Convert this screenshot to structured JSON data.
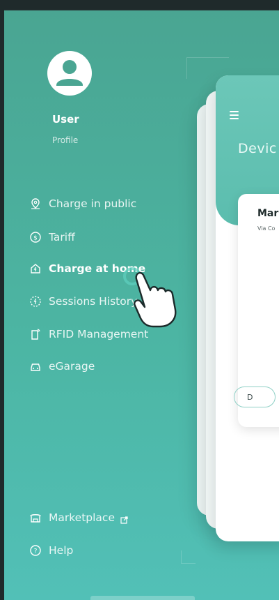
{
  "user": {
    "name": "User",
    "subtitle": "Profile"
  },
  "nav": {
    "items": [
      {
        "label": "Charge in public",
        "icon": "location-pin-icon",
        "active": false
      },
      {
        "label": "Tariff",
        "icon": "dollar-circle-icon",
        "active": false
      },
      {
        "label": "Charge at home",
        "icon": "home-charge-icon",
        "active": true
      },
      {
        "label": "Sessions History",
        "icon": "sessions-history-icon",
        "active": false
      },
      {
        "label": "RFID Management",
        "icon": "rfid-card-icon",
        "active": false
      },
      {
        "label": "eGarage",
        "icon": "car-icon",
        "active": false
      }
    ],
    "bottom": [
      {
        "label": "Marketplace",
        "icon": "marketplace-icon",
        "external_icon": "external-link-icon"
      },
      {
        "label": "Help",
        "icon": "help-circle-icon"
      }
    ]
  },
  "card": {
    "title": "Devic",
    "device_name": "Mar",
    "device_subtitle": "Via Co",
    "button_label": "D"
  },
  "colors": {
    "accent": "#4cb5a3",
    "header": "#6cc7b8",
    "text_on_accent": "#ffffff"
  }
}
